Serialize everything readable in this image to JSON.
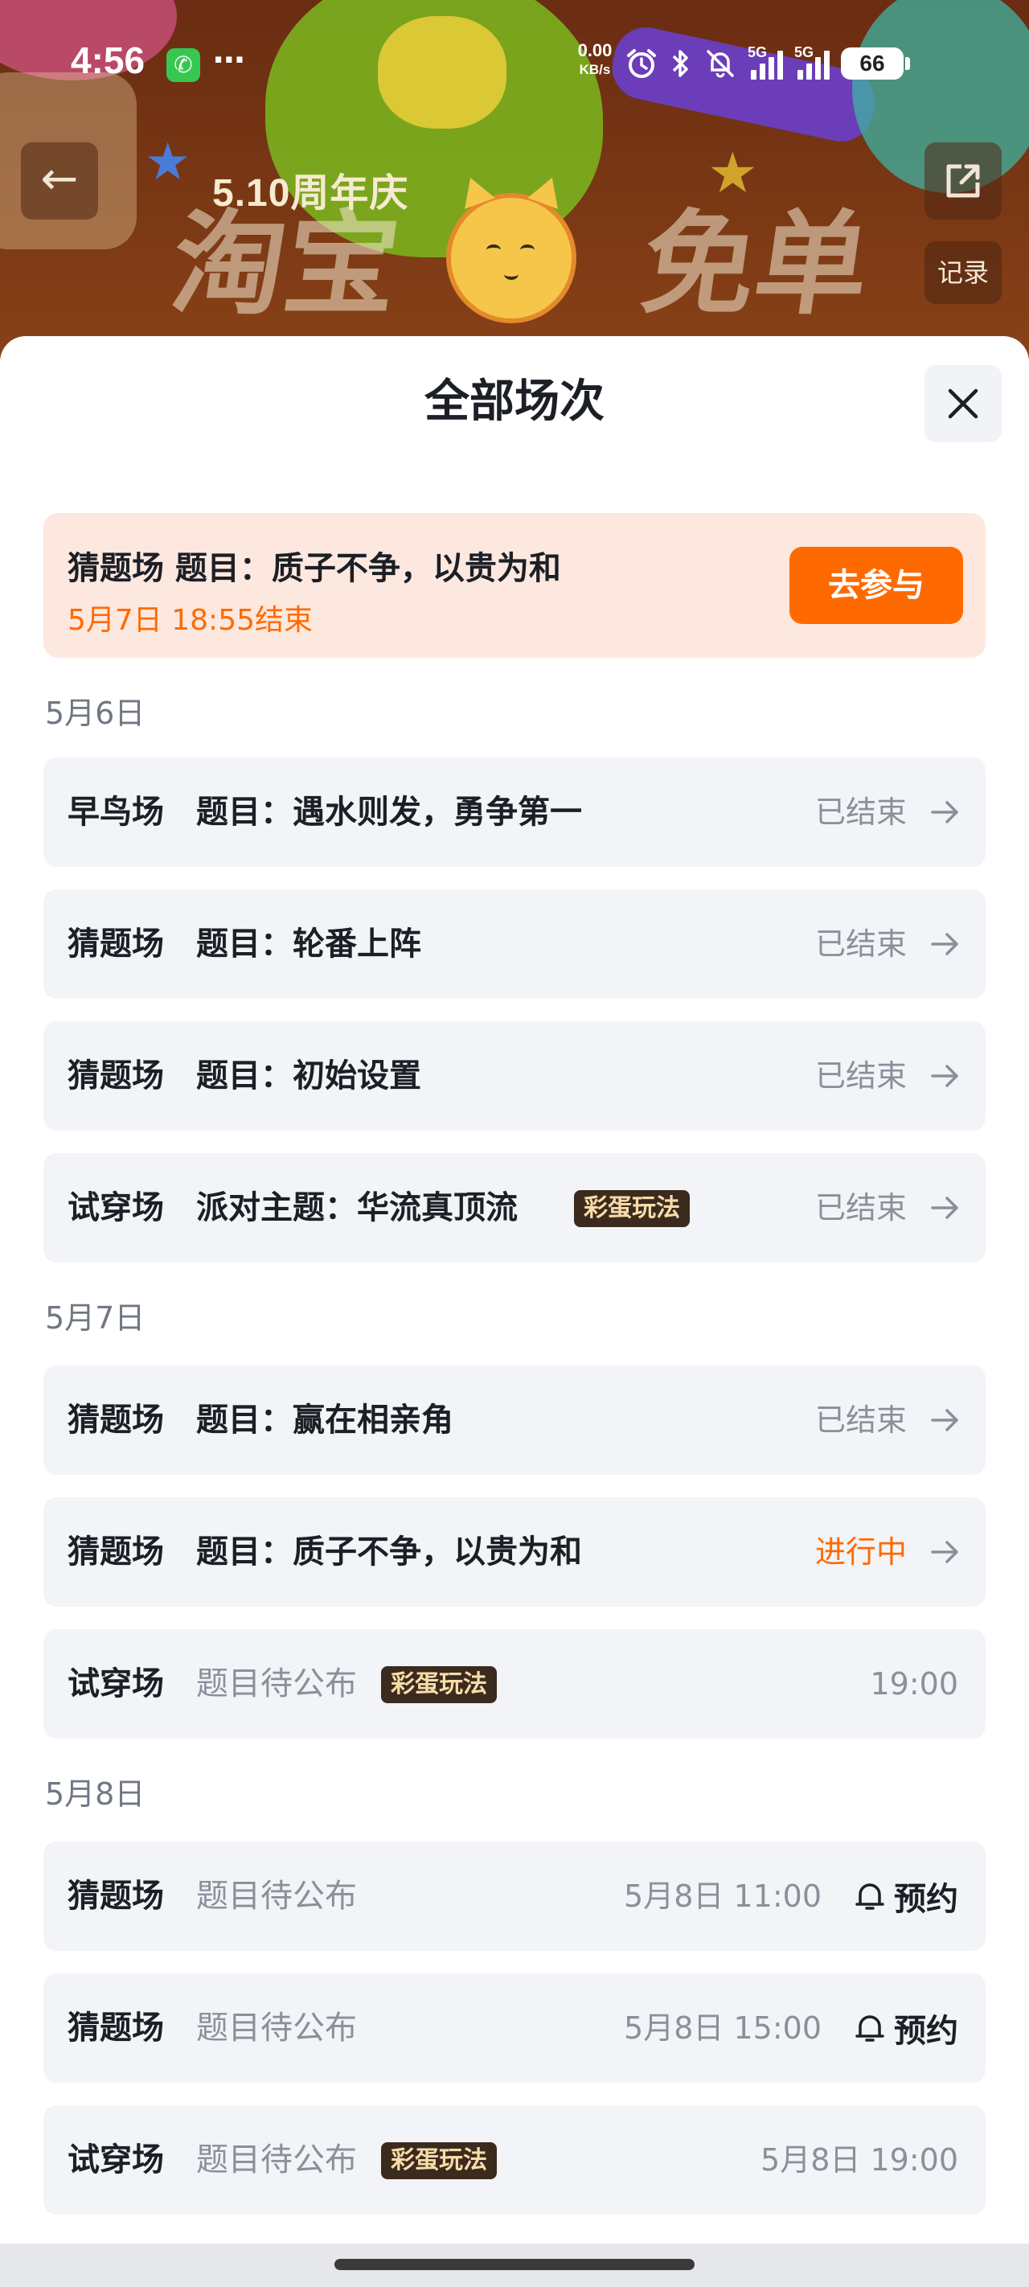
{
  "status_bar": {
    "time": "4:56",
    "net_speed_value": "0.00",
    "net_speed_unit": "KB/s",
    "signal1_label": "5G",
    "signal2_label": "5G",
    "battery": "66"
  },
  "header": {
    "banner_subtitle": "5.10周年庆",
    "banner_title_left": "淘宝",
    "banner_title_right": "免单",
    "record_label": "记录"
  },
  "sheet": {
    "title": "全部场次",
    "current": {
      "title": "猜题场  题目：质子不争，以贵为和",
      "end_time": "5月7日 18:55结束",
      "join_label": "去参与"
    },
    "groups": [
      {
        "date": "5月6日",
        "rows": [
          {
            "type": "早鸟场",
            "topic": "题目：遇水则发，勇争第一",
            "status": "已结束"
          },
          {
            "type": "猜题场",
            "topic": "题目：轮番上阵",
            "status": "已结束"
          },
          {
            "type": "猜题场",
            "topic": "题目：初始设置",
            "status": "已结束"
          },
          {
            "type": "试穿场",
            "topic": "派对主题：华流真顶流",
            "badge": "彩蛋玩法",
            "status": "已结束"
          }
        ]
      },
      {
        "date": "5月7日",
        "rows": [
          {
            "type": "猜题场",
            "topic": "题目：赢在相亲角",
            "status": "已结束"
          },
          {
            "type": "猜题场",
            "topic": "题目：质子不争，以贵为和",
            "status": "进行中"
          },
          {
            "type": "试穿场",
            "topic": "题目待公布",
            "badge": "彩蛋玩法",
            "time": "19:00"
          }
        ]
      },
      {
        "date": "5月8日",
        "rows": [
          {
            "type": "猜题场",
            "topic": "题目待公布",
            "time": "5月8日 11:00",
            "reserve": "预约"
          },
          {
            "type": "猜题场",
            "topic": "题目待公布",
            "time": "5月8日 15:00",
            "reserve": "预约"
          },
          {
            "type": "试穿场",
            "topic": "题目待公布",
            "badge": "彩蛋玩法",
            "time": "5月8日 19:00"
          }
        ]
      }
    ]
  },
  "colors": {
    "accent": "#ff6a00",
    "highlight_bg": "#fde8df",
    "row_bg": "#f2f4f7",
    "badge_bg": "#3b2a1e",
    "badge_text": "#f7dca8",
    "muted_text": "#8a909b"
  },
  "icons": {
    "back": "arrow-left-icon",
    "share": "share-icon",
    "close": "close-icon",
    "row_arrow": "arrow-right-icon",
    "reserve": "bell-icon"
  }
}
